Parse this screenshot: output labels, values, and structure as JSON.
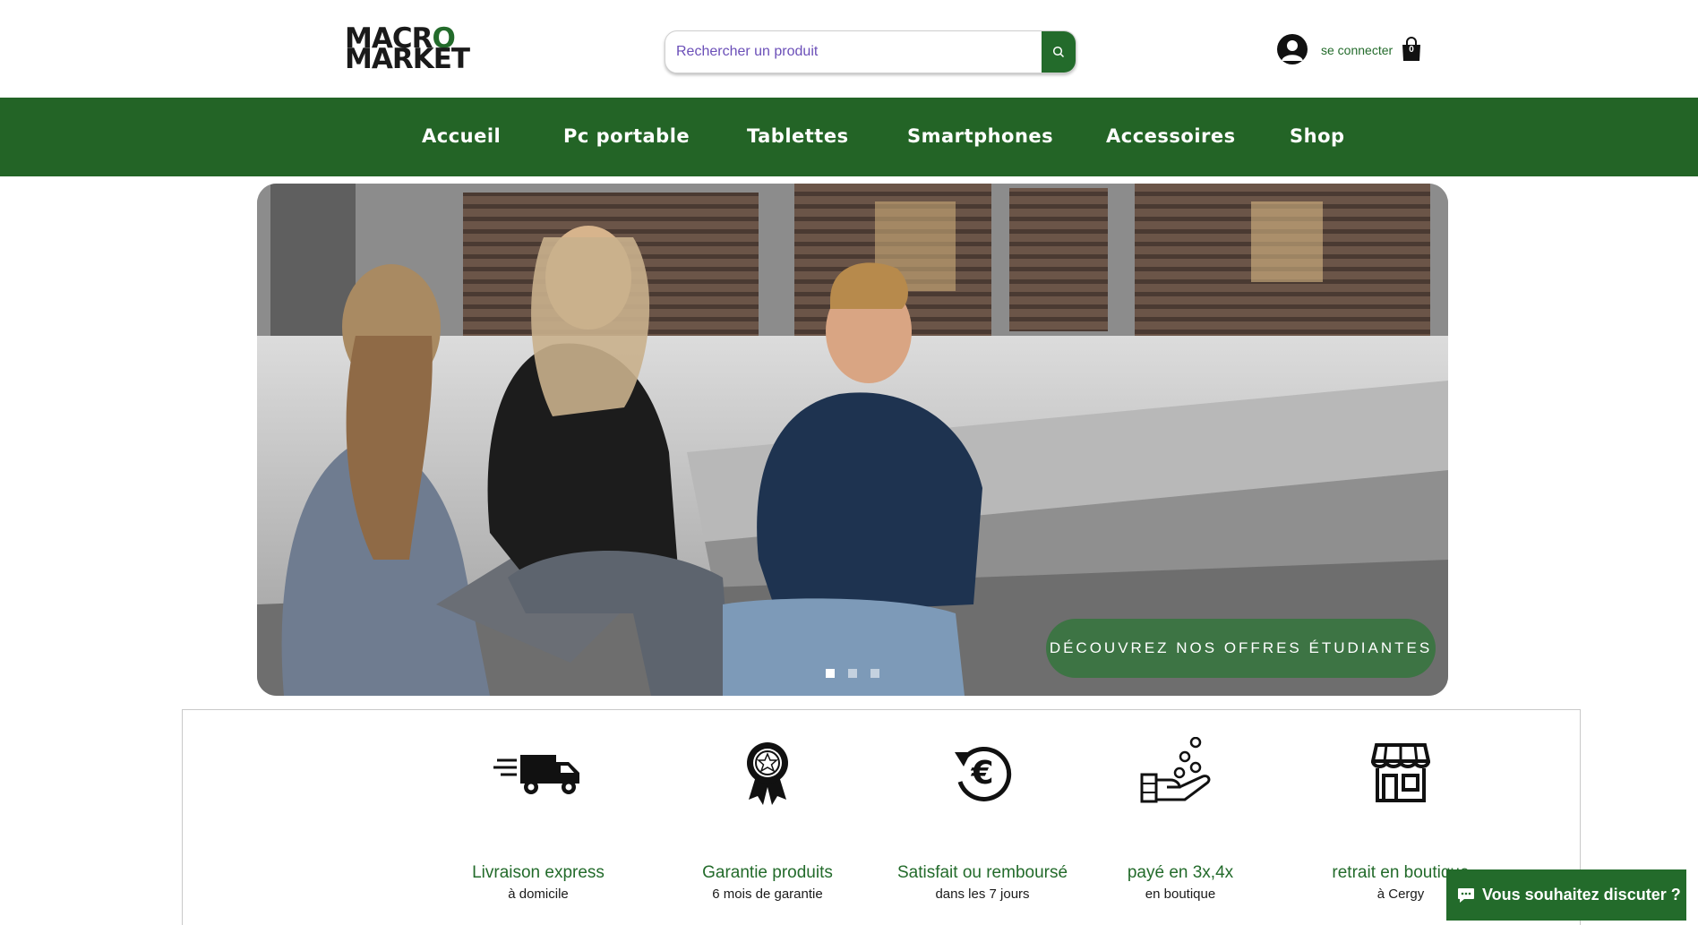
{
  "header": {
    "logo_line1": "MACRO",
    "logo_line2": "MARKET",
    "search_placeholder": "Rechercher un produit",
    "login_label": "se connecter",
    "cart_count": "0"
  },
  "nav": {
    "items": [
      {
        "label": "Accueil"
      },
      {
        "label": "Pc portable"
      },
      {
        "label": "Tablettes"
      },
      {
        "label": "Smartphones"
      },
      {
        "label": "Accessoires"
      },
      {
        "label": "Shop"
      }
    ]
  },
  "hero": {
    "cta_label": "DÉCOUVREZ NOS OFFRES ÉTUDIANTES",
    "slide_count": 3,
    "active_slide": 1
  },
  "features": [
    {
      "icon": "delivery-truck-icon",
      "title": "Livraison express",
      "sub": "à domicile"
    },
    {
      "icon": "award-ribbon-icon",
      "title": "Garantie produits",
      "sub": "6 mois de garantie"
    },
    {
      "icon": "euro-refund-icon",
      "title": "Satisfait ou remboursé",
      "sub": "dans les 7 jours"
    },
    {
      "icon": "hand-coins-icon",
      "title": "payé en 3x,4x",
      "sub": "en boutique"
    },
    {
      "icon": "storefront-icon",
      "title": "retrait en boutique",
      "sub": "à Cergy"
    }
  ],
  "chat": {
    "label": "Vous souhaitez discuter ?"
  },
  "colors": {
    "brand_green": "#236426",
    "cta_green": "#3d7444",
    "accent_purple_text": "#6b4fb8"
  }
}
